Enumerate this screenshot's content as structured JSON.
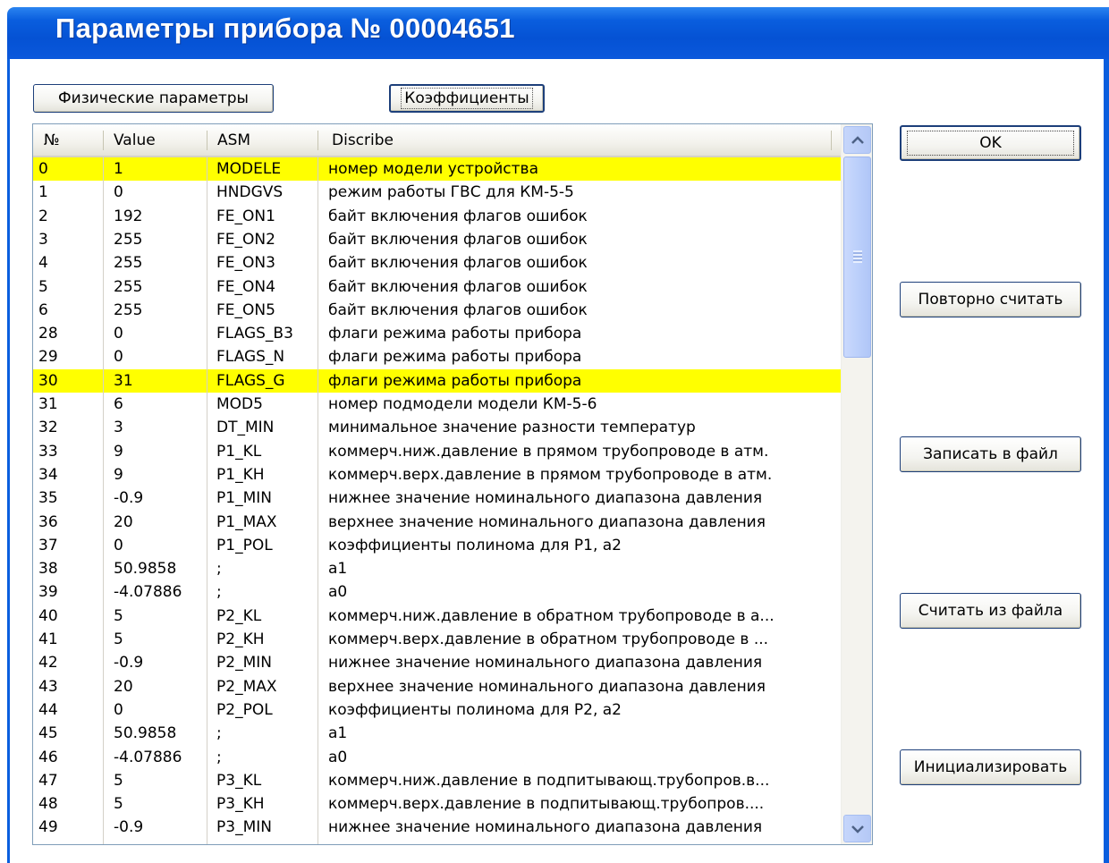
{
  "window": {
    "title": "Параметры прибора № 00004651"
  },
  "tabs": {
    "physical_label": "Физические параметры",
    "coefficients_label": "Коэффициенты"
  },
  "actions": {
    "ok_label": "OK",
    "reread_label": "Повторно считать",
    "save_label": "Записать в файл",
    "load_label": "Считать из файла",
    "init_label": "Инициализировать"
  },
  "table": {
    "columns": [
      "№",
      "Value",
      "ASM",
      "Discribe"
    ],
    "highlight_color": "#ffff00",
    "rows": [
      {
        "no": "0",
        "value": "1",
        "asm": "MODELE",
        "desc": "номер модели устройства",
        "highlighted": true
      },
      {
        "no": "1",
        "value": "0",
        "asm": "HNDGVS",
        "desc": "режим работы ГВС для КМ-5-5",
        "highlighted": false
      },
      {
        "no": "2",
        "value": "192",
        "asm": "FE_ON1",
        "desc": "байт включения флагов ошибок",
        "highlighted": false
      },
      {
        "no": "3",
        "value": "255",
        "asm": "FE_ON2",
        "desc": "байт включения флагов ошибок",
        "highlighted": false
      },
      {
        "no": "4",
        "value": "255",
        "asm": "FE_ON3",
        "desc": "байт включения флагов ошибок",
        "highlighted": false
      },
      {
        "no": "5",
        "value": "255",
        "asm": "FE_ON4",
        "desc": "байт включения флагов ошибок",
        "highlighted": false
      },
      {
        "no": "6",
        "value": "255",
        "asm": "FE_ON5",
        "desc": "байт включения флагов ошибок",
        "highlighted": false
      },
      {
        "no": "28",
        "value": "0",
        "asm": "FLAGS_B3",
        "desc": "флаги режима работы прибора",
        "highlighted": false
      },
      {
        "no": "29",
        "value": "0",
        "asm": "FLAGS_N",
        "desc": "флаги режима работы прибора",
        "highlighted": false
      },
      {
        "no": "30",
        "value": "31",
        "asm": "FLAGS_G",
        "desc": "флаги режима работы прибора",
        "highlighted": true
      },
      {
        "no": "31",
        "value": "6",
        "asm": "MOD5",
        "desc": "номер подмодели модели КМ-5-6",
        "highlighted": false
      },
      {
        "no": "32",
        "value": "3",
        "asm": "DT_MIN",
        "desc": "минимальное значение разности температур",
        "highlighted": false
      },
      {
        "no": "33",
        "value": "9",
        "asm": "P1_KL",
        "desc": "коммерч.ниж.давление в прямом трубопроводе в атм.",
        "highlighted": false
      },
      {
        "no": "34",
        "value": "9",
        "asm": "P1_KH",
        "desc": "коммерч.верх.давление в прямом трубопроводе в атм.",
        "highlighted": false
      },
      {
        "no": "35",
        "value": "-0.9",
        "asm": "P1_MIN",
        "desc": "нижнее значение номинального диапазона давления",
        "highlighted": false
      },
      {
        "no": "36",
        "value": "20",
        "asm": "P1_MAX",
        "desc": "верхнее значение номинального диапазона давления",
        "highlighted": false
      },
      {
        "no": "37",
        "value": "0",
        "asm": "P1_POL",
        "desc": "коэффициенты полинома для P1, a2",
        "highlighted": false
      },
      {
        "no": "38",
        "value": "50.9858",
        "asm": ";",
        "desc": "a1",
        "highlighted": false
      },
      {
        "no": "39",
        "value": "-4.07886",
        "asm": ";",
        "desc": "a0",
        "highlighted": false
      },
      {
        "no": "40",
        "value": "5",
        "asm": "P2_KL",
        "desc": "коммерч.ниж.давление в обратном трубопроводе в а...",
        "highlighted": false
      },
      {
        "no": "41",
        "value": "5",
        "asm": "P2_KH",
        "desc": "коммерч.верх.давление в обратном трубопроводе в ...",
        "highlighted": false
      },
      {
        "no": "42",
        "value": "-0.9",
        "asm": "P2_MIN",
        "desc": "нижнее значение номинального диапазона давления",
        "highlighted": false
      },
      {
        "no": "43",
        "value": "20",
        "asm": "P2_MAX",
        "desc": "верхнее значение номинального диапазона давления",
        "highlighted": false
      },
      {
        "no": "44",
        "value": "0",
        "asm": "P2_POL",
        "desc": "коэффициенты полинома для P2, a2",
        "highlighted": false
      },
      {
        "no": "45",
        "value": "50.9858",
        "asm": ";",
        "desc": "a1",
        "highlighted": false
      },
      {
        "no": "46",
        "value": "-4.07886",
        "asm": ";",
        "desc": "a0",
        "highlighted": false
      },
      {
        "no": "47",
        "value": "5",
        "asm": "P3_KL",
        "desc": "коммерч.ниж.давление в подпитывающ.трубопров.в...",
        "highlighted": false
      },
      {
        "no": "48",
        "value": "5",
        "asm": "P3_KH",
        "desc": "коммерч.верх.давление в подпитывающ.трубопров....",
        "highlighted": false
      },
      {
        "no": "49",
        "value": "-0.9",
        "asm": "P3_MIN",
        "desc": "нижнее значение номинального диапазона давления",
        "highlighted": false
      }
    ]
  },
  "scrollbar": {
    "up_icon": "scroll-up-arrow",
    "down_icon": "scroll-down-arrow"
  },
  "colors": {
    "titlebar": "#0a5ede",
    "title_text": "#ffffff",
    "button_border": "#1d3f7a"
  }
}
